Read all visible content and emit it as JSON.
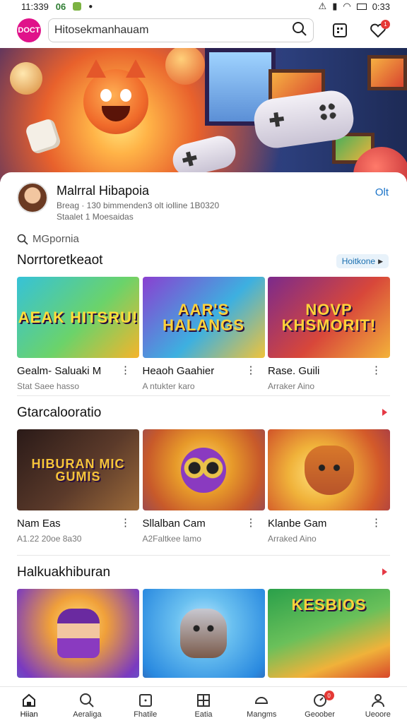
{
  "status_bar": {
    "time": "11:339",
    "app_icons": [
      "06"
    ],
    "right_time": "0:33"
  },
  "header": {
    "logo_text": "DOCT",
    "search_text": "Hitosekmanhauam",
    "notif_badge": "1"
  },
  "profile": {
    "name": "Malrral Hibapoia",
    "sub1": "Breag · 130 bimmenden3 olt iolline 1B0320",
    "sub2": "Staalet 1 Moesaidas",
    "action": "Olt"
  },
  "mini_search": "MGpornia",
  "sections": [
    {
      "title": "Norrtoretkeaot",
      "chip": "Hoitkone",
      "cards": [
        {
          "title": "Gealm- Saluaki M",
          "sub": "Stat Saee hasso",
          "thumb": "AEAK HITSRU!",
          "bg": [
            "#36c2d8",
            "#6bd36a",
            "#f5b42b"
          ]
        },
        {
          "title": "Heaoh Gaahier",
          "sub": "A ntukter karo",
          "thumb": "AAR'S HALANGS",
          "bg": [
            "#8a3fd1",
            "#3db0e0",
            "#f0c33a"
          ]
        },
        {
          "title": "Rase. Guili",
          "sub": "Arraker Aino",
          "thumb": "NOVP KHSMORIT!",
          "bg": [
            "#7b2a8c",
            "#d8473a",
            "#f3b23a"
          ]
        }
      ]
    },
    {
      "title": "Gtarcalooratio",
      "cards": [
        {
          "title": "Nam Eas",
          "sub": "A1.22 20oe 8a30",
          "thumb": "HIBURAN MIC GUMIS",
          "bg": [
            "#2a1a18",
            "#5b3a2a",
            "#9c6a3a"
          ]
        },
        {
          "title": "Sllalban Cam",
          "sub": "A2Faltkee lamo",
          "thumb": "",
          "bg": [
            "#e79a2a",
            "#c85a2a",
            "#6a3a7a"
          ]
        },
        {
          "title": "Klanbe Gam",
          "sub": "Arraked Aino",
          "thumb": "",
          "bg": [
            "#f0b23a",
            "#d35a2a",
            "#8a2a5a"
          ]
        }
      ]
    },
    {
      "title": "Halkuakhiburan",
      "cards": [
        {
          "title": "",
          "sub": "",
          "thumb": "",
          "bg": [
            "#f0a03a",
            "#7a3ac0",
            "#3a8ad8"
          ]
        },
        {
          "title": "",
          "sub": "",
          "thumb": "",
          "bg": [
            "#2a8ae0",
            "#6ac0f0",
            "#3a2a6a"
          ]
        },
        {
          "title": "",
          "sub": "",
          "thumb": "KESBIOS",
          "bg": [
            "#2aa04a",
            "#f0b23a",
            "#d8472a"
          ]
        }
      ]
    }
  ],
  "bottom_nav": [
    {
      "label": "Hiian",
      "icon": "home-icon",
      "active": true
    },
    {
      "label": "Aeraliga",
      "icon": "search-icon"
    },
    {
      "label": "Fhatile",
      "icon": "square-icon"
    },
    {
      "label": "Eatia",
      "icon": "grid-icon"
    },
    {
      "label": "Mangms",
      "icon": "chat-icon"
    },
    {
      "label": "Geoober",
      "icon": "gauge-icon",
      "badge": "0"
    },
    {
      "label": "Ueoore",
      "icon": "user-icon"
    }
  ],
  "colors": {
    "brand": "#e0128a",
    "link": "#1a73c8",
    "accent_red": "#e53945"
  }
}
